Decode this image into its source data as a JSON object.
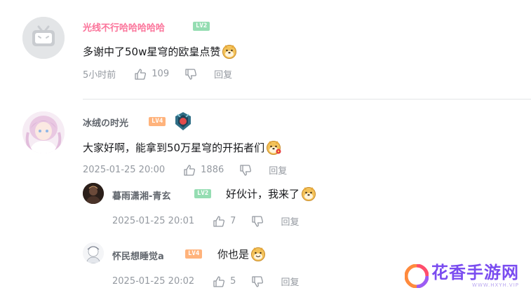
{
  "comments": [
    {
      "username": "光线不行哈哈哈哈哈",
      "level": "LV2",
      "text": "多谢中了50w星穹的欧皇点赞",
      "time": "5小时前",
      "likes": "109",
      "reply": "回复"
    },
    {
      "username": "冰绒の时光",
      "level": "LV4",
      "text": "大家好啊，能拿到50万星穹的开拓者们",
      "time": "2025-01-25 20:00",
      "likes": "1886",
      "reply": "回复",
      "replies": [
        {
          "username": "暮雨潇湘-青玄",
          "level": "LV2",
          "text": "好伙计，我来了",
          "time": "2025-01-25 20:01",
          "likes": "7",
          "reply": "回复"
        },
        {
          "username": "怀民想睡觉a",
          "level": "LV4",
          "text": "你也是",
          "time": "2025-01-25 20:02",
          "likes": "5",
          "reply": "回复"
        }
      ]
    }
  ],
  "watermark": {
    "title": "花香手游网",
    "url": "WWW.HXYH.VIP"
  },
  "colors": {
    "username_pink": "#fb7299",
    "username_gray": "#61666d",
    "meta_gray": "#9499a0",
    "level_green": "#95ddb2",
    "level_orange": "#ffb37c",
    "watermark_purple": "#7a4cf0"
  }
}
